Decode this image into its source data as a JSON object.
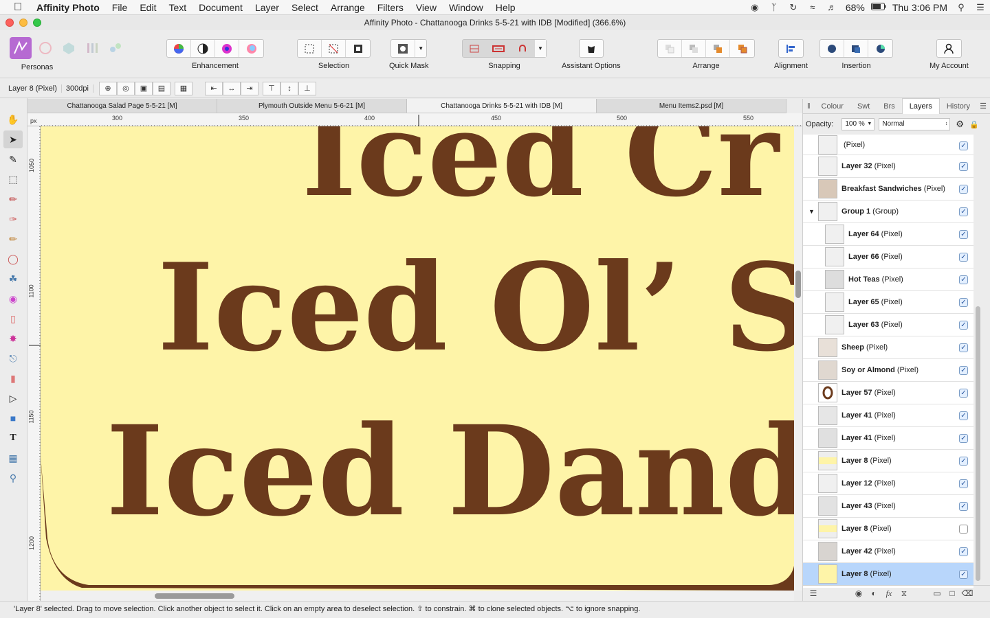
{
  "menubar": {
    "app": "Affinity Photo",
    "items": [
      "File",
      "Edit",
      "Text",
      "Document",
      "Layer",
      "Select",
      "Arrange",
      "Filters",
      "View",
      "Window",
      "Help"
    ],
    "battery": "68%",
    "clock": "Thu 3:06 PM"
  },
  "window": {
    "title": "Affinity Photo - Chattanooga Drinks 5-5-21 with IDB [Modified] (366.6%)"
  },
  "toolbar": {
    "personas": "Personas",
    "enhancement": "Enhancement",
    "selection": "Selection",
    "quick_mask": "Quick Mask",
    "snapping": "Snapping",
    "assistant": "Assistant Options",
    "arrange": "Arrange",
    "alignment": "Alignment",
    "insertion": "Insertion",
    "account": "My Account"
  },
  "context": {
    "layer": "Layer 8 (Pixel)",
    "dpi": "300dpi"
  },
  "doc_tabs": [
    "Chattanooga Salad Page 5-5-21 [M]",
    "Plymouth Outside Menu 5-6-21 [M]",
    "Chattanooga Drinks 5-5-21 with IDB [M]",
    "Menu Items2.psd [M]"
  ],
  "ruler": {
    "unit": "px",
    "top": [
      "300",
      "350",
      "400",
      "450",
      "500",
      "550"
    ],
    "left": [
      "1050",
      "1100",
      "1150",
      "1200"
    ]
  },
  "canvas": {
    "line1": "Iced Cr",
    "line2": "Iced Ol’ S",
    "line3": "Iced Dand"
  },
  "panel": {
    "tabs": [
      "Colour",
      "Swt",
      "Brs",
      "Layers",
      "History"
    ],
    "active_tab": "Layers",
    "opacity_label": "Opacity:",
    "opacity_value": "100 %",
    "blend_mode": "Normal",
    "layers": [
      {
        "name": "",
        "kind": "(Pixel)",
        "visible": true
      },
      {
        "name": "Layer 32",
        "kind": "(Pixel)",
        "visible": true
      },
      {
        "name": "Breakfast Sandwiches",
        "kind": "(Pixel)",
        "visible": true
      },
      {
        "name": "Group 1",
        "kind": "(Group)",
        "visible": true
      },
      {
        "name": "Layer 64",
        "kind": "(Pixel)",
        "visible": true
      },
      {
        "name": "Layer 66",
        "kind": "(Pixel)",
        "visible": true
      },
      {
        "name": "Hot Teas",
        "kind": "(Pixel)",
        "visible": true
      },
      {
        "name": "Layer 65",
        "kind": "(Pixel)",
        "visible": true
      },
      {
        "name": "Layer 63",
        "kind": "(Pixel)",
        "visible": true
      },
      {
        "name": "Sheep",
        "kind": "(Pixel)",
        "visible": true
      },
      {
        "name": "Soy or Almond",
        "kind": "(Pixel)",
        "visible": true
      },
      {
        "name": "Layer 57",
        "kind": "(Pixel)",
        "visible": true
      },
      {
        "name": "Layer 41",
        "kind": "(Pixel)",
        "visible": true
      },
      {
        "name": "Layer 41",
        "kind": "(Pixel)",
        "visible": true
      },
      {
        "name": "Layer 8",
        "kind": "(Pixel)",
        "visible": true
      },
      {
        "name": "Layer 12",
        "kind": "(Pixel)",
        "visible": true
      },
      {
        "name": "Layer 43",
        "kind": "(Pixel)",
        "visible": true
      },
      {
        "name": "Layer 8",
        "kind": "(Pixel)",
        "visible": false
      },
      {
        "name": "Layer 42",
        "kind": "(Pixel)",
        "visible": true
      },
      {
        "name": "Layer 8",
        "kind": "(Pixel)",
        "visible": true
      }
    ]
  },
  "status": {
    "text": "'Layer 8' selected. Drag to move selection. Click another object to select it. Click on an empty area to deselect selection. ⇧ to constrain. ⌘ to clone selected objects. ⌥ to ignore snapping."
  },
  "colors": {
    "canvas_bg": "#fef4a8",
    "text_brown": "#6b3a1c",
    "selected_row": "#b8d6fb"
  }
}
